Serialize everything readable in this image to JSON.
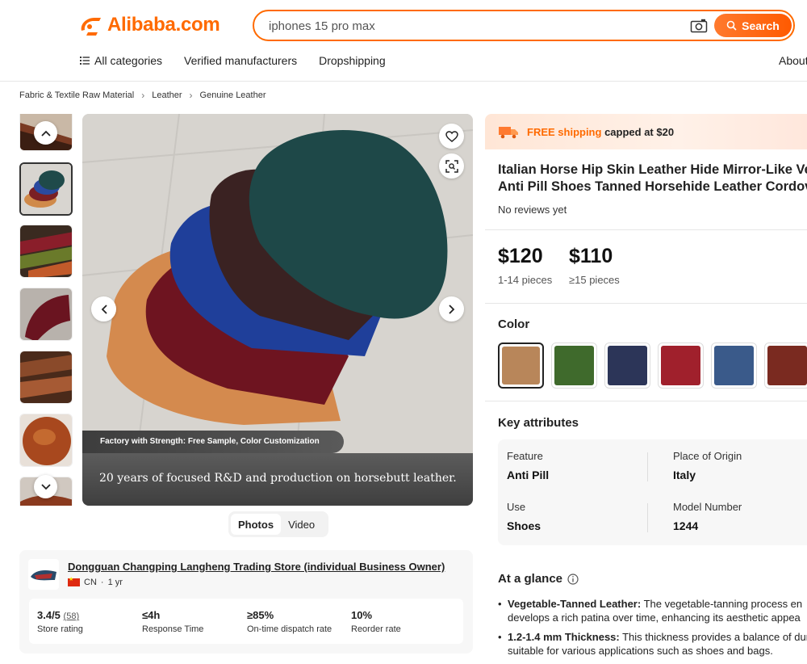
{
  "header": {
    "logo_text": "Alibaba.com",
    "search_value": "iphones 15 pro max",
    "search_button": "Search",
    "nav": [
      "All categories",
      "Verified manufacturers",
      "Dropshipping"
    ],
    "nav_right": "About"
  },
  "breadcrumb": [
    "Fabric & Textile Raw Material",
    "Leather",
    "Genuine Leather"
  ],
  "gallery": {
    "caption_small": "Factory with Strength: Free Sample, Color Customization",
    "caption_large": "20 years of focused R&D and production on horsebutt leather.",
    "tabs": [
      "Photos",
      "Video"
    ]
  },
  "store": {
    "name": "Dongguan Changping Langheng Trading Store (individual Business Owner)",
    "country": "CN",
    "years": "1 yr",
    "stats": [
      {
        "value": "3.4/5",
        "count": "(58)",
        "label": "Store rating"
      },
      {
        "value": "≤4h",
        "count": "",
        "label": "Response Time"
      },
      {
        "value": "≥85%",
        "count": "",
        "label": "On-time dispatch rate"
      },
      {
        "value": "10%",
        "count": "",
        "label": "Reorder rate"
      }
    ]
  },
  "shipping": {
    "free": "FREE shipping",
    "rest": "capped at $20"
  },
  "product": {
    "title_line1": "Italian Horse Hip Skin Leather Hide Mirror-Like Ve",
    "title_line2": "Anti Pill Shoes Tanned Horsehide Leather Cordov",
    "reviews": "No reviews yet",
    "prices": [
      {
        "value": "$120",
        "qty": "1-14 pieces"
      },
      {
        "value": "$110",
        "qty": "≥15 pieces"
      }
    ],
    "color_label": "Color",
    "colors": [
      "#b8865a",
      "#3f6a2c",
      "#2c3558",
      "#a0202c",
      "#3a5a8a",
      "#7a2a20"
    ],
    "key_attributes_label": "Key attributes",
    "attributes": [
      {
        "label": "Feature",
        "value": "Anti Pill"
      },
      {
        "label": "Place of Origin",
        "value": "Italy"
      },
      {
        "label": "Use",
        "value": "Shoes"
      },
      {
        "label": "Model Number",
        "value": "1244"
      }
    ],
    "glance_label": "At a glance",
    "glance": [
      {
        "bold": "Vegetable-Tanned Leather:",
        "text": " The vegetable-tanning process en",
        "line2": "develops a rich patina over time, enhancing its aesthetic appea"
      },
      {
        "bold": "1.2-1.4 mm Thickness:",
        "text": " This thickness provides a balance of dur",
        "line2": "suitable for various applications such as shoes and bags."
      }
    ]
  }
}
